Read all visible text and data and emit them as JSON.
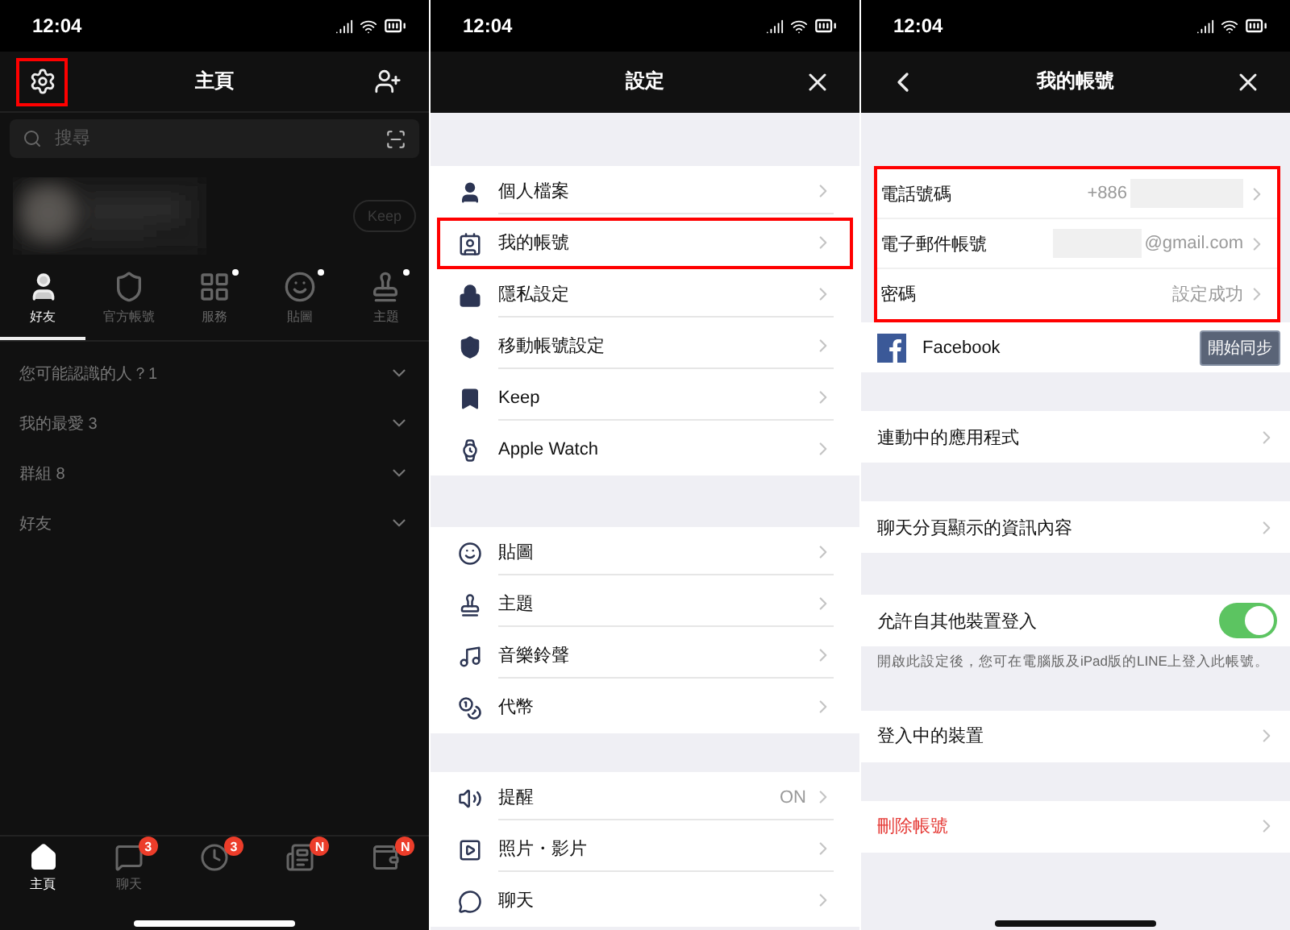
{
  "home_screen": {
    "status_time": "12:04",
    "title": "主頁",
    "settings_highlighted": true,
    "search": {
      "placeholder": "搜尋"
    },
    "keep_button": "Keep",
    "tabs": [
      {
        "label": "好友",
        "selected": true,
        "dot": false
      },
      {
        "label": "官方帳號",
        "selected": false,
        "dot": false
      },
      {
        "label": "服務",
        "selected": false,
        "dot": true
      },
      {
        "label": "貼圖",
        "selected": false,
        "dot": true
      },
      {
        "label": "主題",
        "selected": false,
        "dot": true
      }
    ],
    "sections": [
      {
        "label": "您可能認識的人？1"
      },
      {
        "label": "我的最愛 3"
      },
      {
        "label": "群組 8"
      },
      {
        "label": "好友"
      }
    ],
    "bottom_tabs": [
      {
        "label": "主頁",
        "selected": true
      },
      {
        "label": "聊天",
        "selected": false,
        "badge": "3"
      },
      {
        "selected": false,
        "badge": "3"
      },
      {
        "selected": false,
        "badge": "N"
      },
      {
        "selected": false,
        "badge": "N"
      }
    ]
  },
  "settings_screen": {
    "status_time": "12:04",
    "title": "設定",
    "groups": [
      {
        "items": [
          {
            "label": "個人檔案",
            "highlighted": false
          },
          {
            "label": "我的帳號",
            "highlighted": true
          },
          {
            "label": "隱私設定",
            "highlighted": false
          },
          {
            "label": "移動帳號設定",
            "highlighted": false
          },
          {
            "label": "Keep",
            "highlighted": false
          },
          {
            "label": "Apple Watch",
            "highlighted": false
          }
        ]
      },
      {
        "items": [
          {
            "label": "貼圖",
            "highlighted": false
          },
          {
            "label": "主題",
            "highlighted": false
          },
          {
            "label": "音樂鈴聲",
            "highlighted": false
          },
          {
            "label": "代幣",
            "highlighted": false
          }
        ]
      },
      {
        "items": [
          {
            "label": "提醒",
            "value": "ON",
            "highlighted": false
          },
          {
            "label": "照片・影片",
            "highlighted": false
          },
          {
            "label": "聊天",
            "highlighted": false
          }
        ]
      }
    ]
  },
  "account_screen": {
    "status_time": "12:04",
    "title": "我的帳號",
    "account_group": {
      "highlighted": true,
      "rows": [
        {
          "kind": "phone",
          "label": "電話號碼",
          "value": "+886"
        },
        {
          "kind": "email",
          "label": "電子郵件帳號",
          "value": "@gmail.com"
        },
        {
          "kind": "password",
          "label": "密碼",
          "value": "設定成功"
        }
      ]
    },
    "facebook": {
      "label": "Facebook",
      "button": "開始同步"
    },
    "sections": [
      {
        "kind": "link",
        "label": "連動中的應用程式"
      },
      {
        "kind": "link",
        "label": "聊天分頁顯示的資訊內容"
      },
      {
        "kind": "toggle",
        "label": "允許自其他裝置登入",
        "on": true,
        "note": "開啟此設定後，您可在電腦版及iPad版的LINE上登入此帳號。"
      },
      {
        "kind": "link",
        "label": "登入中的裝置"
      },
      {
        "kind": "danger",
        "label": "刪除帳號"
      }
    ]
  }
}
